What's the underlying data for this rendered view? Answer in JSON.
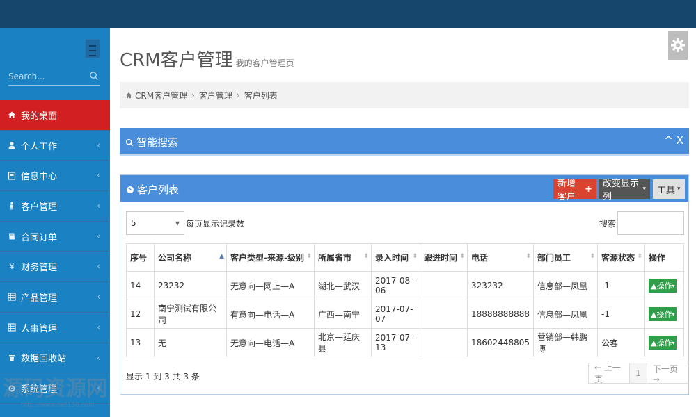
{
  "sidebar": {
    "search_placeholder": "Search...",
    "items": [
      {
        "label": "我的桌面",
        "icon": "home-icon",
        "active": true
      },
      {
        "label": "个人工作",
        "icon": "user-icon"
      },
      {
        "label": "信息中心",
        "icon": "info-icon"
      },
      {
        "label": "客户管理",
        "icon": "person-icon"
      },
      {
        "label": "合同订单",
        "icon": "book-icon"
      },
      {
        "label": "财务管理",
        "icon": "yen-icon"
      },
      {
        "label": "产品管理",
        "icon": "grid-icon"
      },
      {
        "label": "人事管理",
        "icon": "grid-icon"
      },
      {
        "label": "数据回收站",
        "icon": "trash-icon"
      },
      {
        "label": "系统管理",
        "icon": "gear-icon"
      }
    ],
    "chevron": "‹"
  },
  "header": {
    "title": "CRM客户管理",
    "subtitle": "我的客户管理页"
  },
  "breadcrumb": [
    "CRM客户管理",
    "客户管理",
    "客户列表"
  ],
  "search_panel": {
    "title": "智能搜索",
    "tools": "^ X"
  },
  "list_panel": {
    "title": "客户列表",
    "new_button": "新增客户",
    "columns_button": "改变显示列",
    "tools_button": "工具",
    "page_size": "5",
    "page_size_label": "每页显示记录数",
    "search_label": "搜索:",
    "columns": [
      "序号",
      "公司名称",
      "客户类型-来源-级别",
      "所属省市",
      "录入时间",
      "跟进时间",
      "电话",
      "部门员工",
      "客源状态",
      "操作"
    ],
    "rows": [
      [
        "14",
        "23232",
        "无意向—网上—A",
        "湖北—武汉",
        "2017-08-06",
        "",
        "323232",
        "信息部—凤凰",
        "-1",
        "操作"
      ],
      [
        "12",
        "南宁测试有限公司",
        "有意向—电话—A",
        "广西—南宁",
        "2017-07-07",
        "",
        "18888888888",
        "信息部—凤凰",
        "-1",
        "操作"
      ],
      [
        "13",
        "无",
        "无意向—电话—A",
        "北京—延庆县",
        "2017-07-13",
        "",
        "18602448805",
        "营销部—韩鹏博",
        "公客",
        "操作"
      ]
    ],
    "info": "显示 1 到 3 共 3 条",
    "pager": {
      "prev": "← 上一页",
      "current": "1",
      "next": "下一页 →"
    }
  },
  "watermark": {
    "big": "源码资源网",
    "small": "http://www.net188.com"
  },
  "colors": {
    "topbar": "#16466b",
    "sidebar": "#1a81c3",
    "active": "#d21f22",
    "panel": "#4a8edb",
    "new_btn": "#d9432f",
    "op_btn": "#2e9e48"
  }
}
